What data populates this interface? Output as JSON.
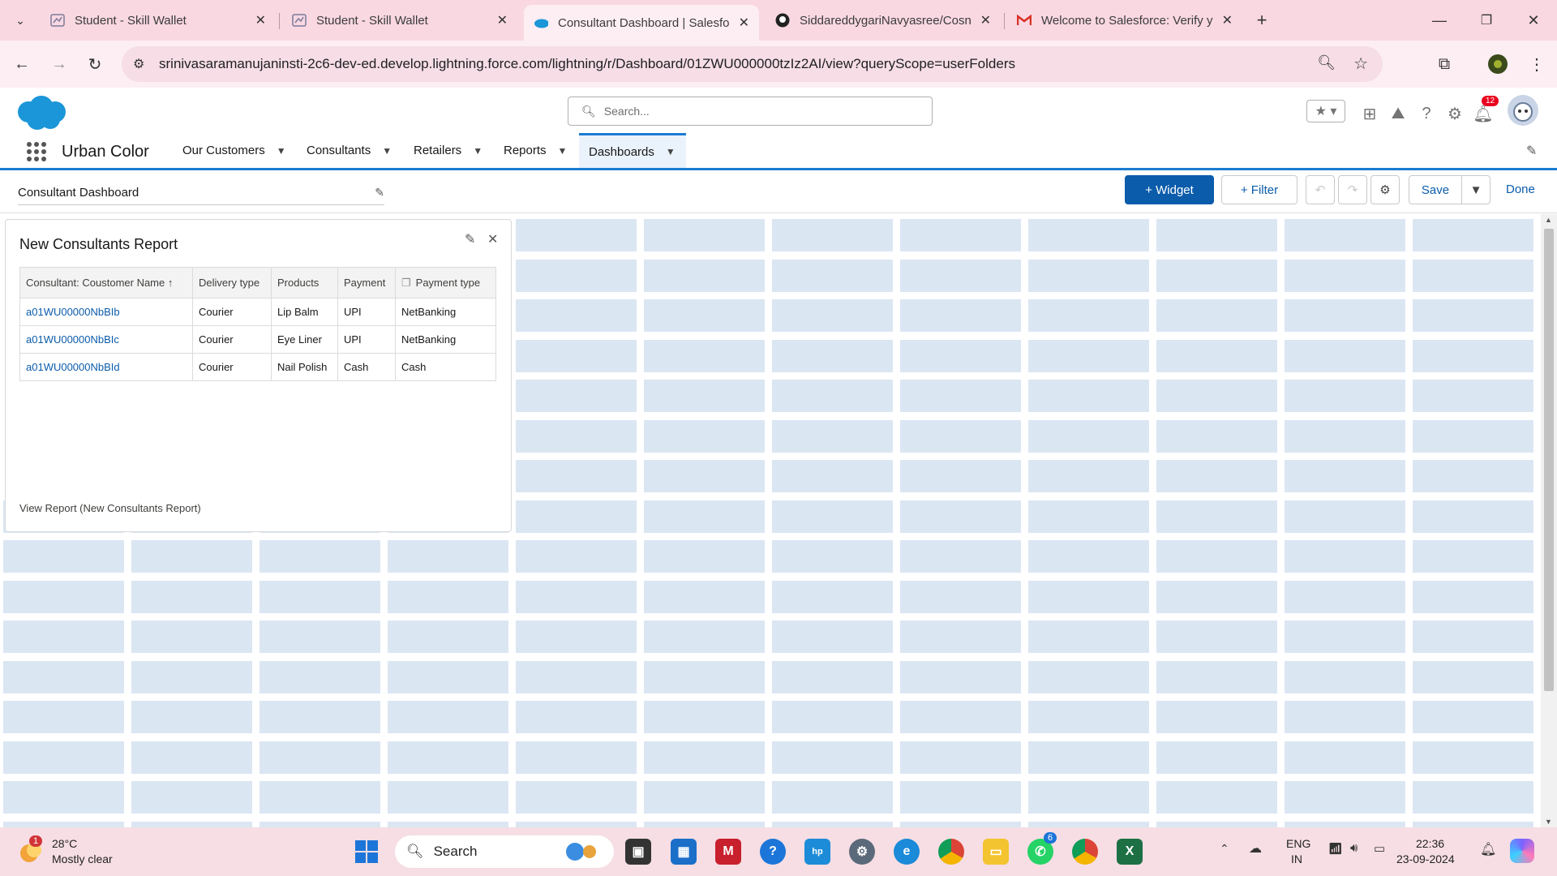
{
  "browser": {
    "tabs": [
      {
        "title": "Student - Skill Wallet",
        "icon": "skillwallet-icon"
      },
      {
        "title": "Student - Skill Wallet",
        "icon": "skillwallet-icon"
      },
      {
        "title": "Consultant Dashboard | Salesfo",
        "icon": "salesforce-icon"
      },
      {
        "title": "SiddareddygariNavyasree/Cosn",
        "icon": "github-icon"
      },
      {
        "title": "Welcome to Salesforce: Verify y",
        "icon": "gmail-icon"
      }
    ],
    "url": "srinivasaramanujaninsti-2c6-dev-ed.develop.lightning.force.com/lightning/r/Dashboard/01ZWU000000tzIz2AI/view?queryScope=userFolders"
  },
  "header": {
    "search_placeholder": "Search...",
    "notification_count": "12"
  },
  "appnav": {
    "app_name": "Urban Color",
    "items": [
      "Our Customers",
      "Consultants",
      "Retailers",
      "Reports",
      "Dashboards"
    ]
  },
  "toolbar": {
    "dashboard_title": "Consultant Dashboard",
    "widget_label": "+ Widget",
    "filter_label": "+ Filter",
    "save_label": "Save",
    "done_label": "Done"
  },
  "widget": {
    "title": "New Consultants Report",
    "columns": [
      "Consultant: Coustomer Name ↑",
      "Delivery type",
      "Products",
      "Payment",
      "Payment type"
    ],
    "rows": [
      [
        "a01WU00000NbBIb",
        "Courier",
        "Lip Balm",
        "UPI",
        "NetBanking"
      ],
      [
        "a01WU00000NbBIc",
        "Courier",
        "Eye Liner",
        "UPI",
        "NetBanking"
      ],
      [
        "a01WU00000NbBId",
        "Courier",
        "Nail Polish",
        "Cash",
        "Cash"
      ]
    ],
    "view_report": "View Report (New Consultants Report)"
  },
  "taskbar": {
    "weather_temp": "28°C",
    "weather_desc": "Mostly clear",
    "weather_badge": "1",
    "search_label": "Search",
    "whatsapp_badge": "6",
    "lang": "ENG",
    "region": "IN",
    "time": "22:36",
    "date": "23-09-2024"
  },
  "colors": {
    "brand": "#0b5cab",
    "grid_cell": "#dbe6f3",
    "tabbar": "#f9d8e2"
  }
}
